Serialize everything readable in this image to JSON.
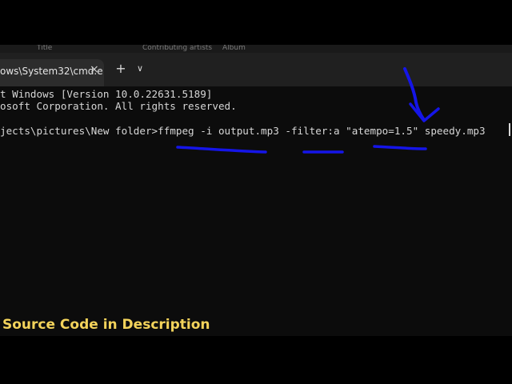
{
  "explorer_header": {
    "col_title": "Title",
    "col_contributing_artists": "Contributing artists",
    "col_album": "Album"
  },
  "terminal": {
    "tab_title": "ows\\System32\\cmd.e",
    "close_glyph": "×",
    "new_tab_glyph": "+",
    "dropdown_glyph": "∨",
    "lines": [
      "t Windows [Version 10.0.22631.5189]",
      "osoft Corporation. All rights reserved.",
      "jects\\pictures\\New folder>ffmpeg -i output.mp3 -filter:a \"atempo=1.5\" speedy.mp3"
    ]
  },
  "annotation": {
    "color": "#1515e8"
  },
  "overlay_caption": "Source Code in  Description"
}
